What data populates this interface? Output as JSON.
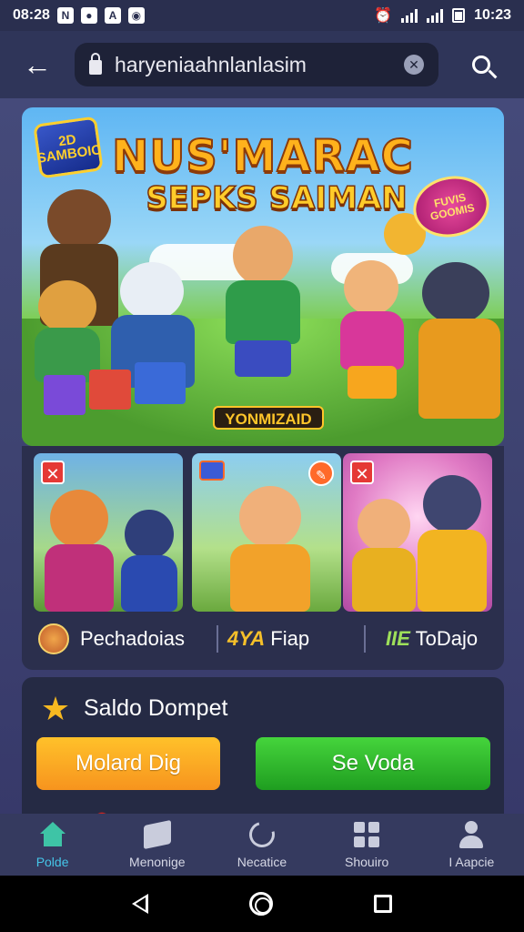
{
  "status_bar": {
    "time_left": "08:28",
    "time_right": "10:23",
    "app_icons": [
      "N",
      "●",
      "A",
      "◉"
    ]
  },
  "browser": {
    "url": "haryeniaahnlanlasim"
  },
  "hero": {
    "logo_text": "2D SAMBOIC",
    "title": "NUS'MARAC",
    "subtitle": "SEPKS SAIMAN",
    "badge_text": "FUVIS GOOMIS",
    "tag_text": "YONMIZAID"
  },
  "cards": [
    {
      "close": "✕"
    },
    {
      "badge": "✎"
    },
    {
      "close": "✕"
    }
  ],
  "stats": {
    "item1": "Pechadoias",
    "item2_highlight": "4YA",
    "item2_text": "Fiap",
    "item3_highlight": "IIE",
    "item3_text": "ToDajo"
  },
  "wallet": {
    "title": "Saldo Dompet",
    "button_left": "Molard Dig",
    "button_right": "Se Voda"
  },
  "bottom_nav": [
    {
      "label": "Polde",
      "active": true
    },
    {
      "label": "Menonige",
      "active": false
    },
    {
      "label": "Necatice",
      "active": false
    },
    {
      "label": "Shouiro",
      "active": false
    },
    {
      "label": "I Aapcie",
      "active": false
    }
  ],
  "colors": {
    "accent_active": "#45c5e8",
    "orange_button": "#f7941e",
    "green_button": "#1f9e20"
  }
}
